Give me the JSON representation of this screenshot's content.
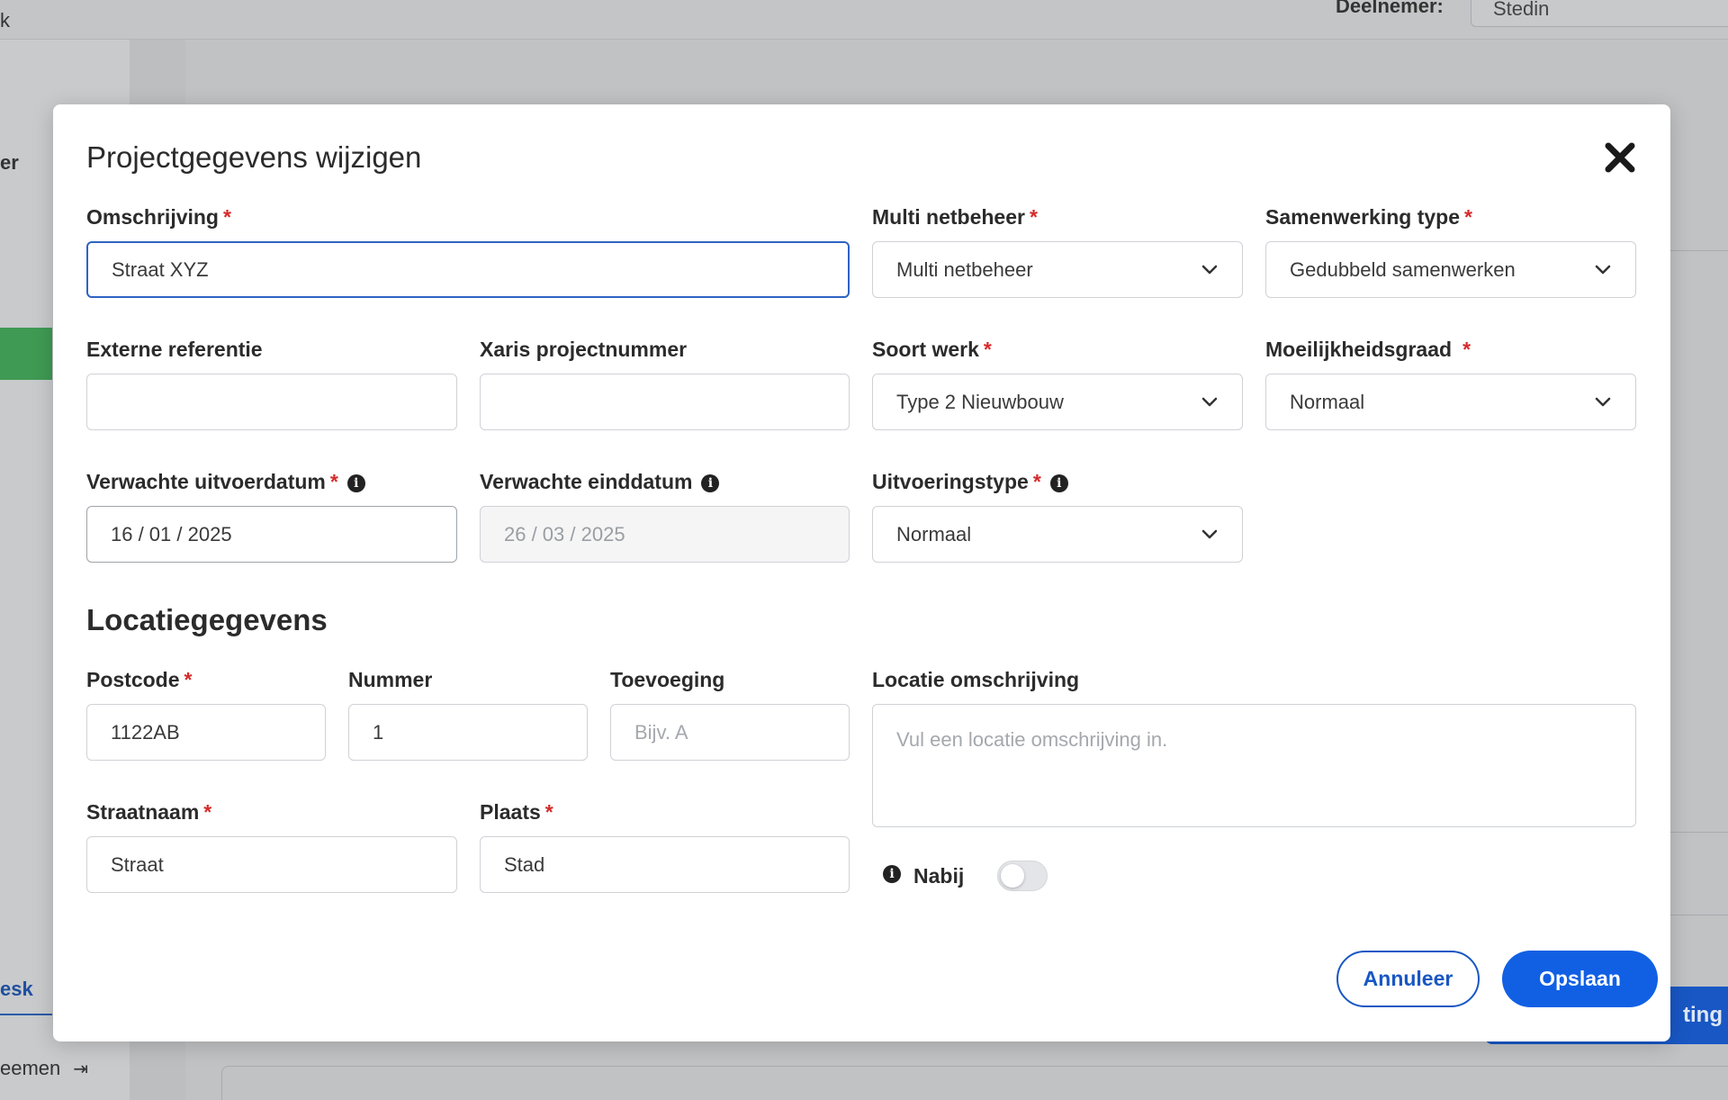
{
  "background": {
    "top_label": "Deelnemer:",
    "top_select_value": "Stedin",
    "sidebar_fragment_top": "k",
    "sidebar_fragment_mid": "er",
    "sidebar_fragment_link": "esk",
    "sidebar_fragment_bottom": "eemen",
    "bg_button_fragment": "ting o"
  },
  "modal": {
    "title": "Projectgegevens wijzigen",
    "close_icon": "close-x-icon",
    "required_mark": "*",
    "fields": {
      "omschrijving": {
        "label": "Omschrijving",
        "value": "Straat XYZ"
      },
      "multi_netbeheer": {
        "label": "Multi netbeheer",
        "value": "Multi netbeheer"
      },
      "samenwerking_type": {
        "label": "Samenwerking type",
        "value": "Gedubbeld samenwerken"
      },
      "externe_referentie": {
        "label": "Externe referentie",
        "value": ""
      },
      "xaris_projectnummer": {
        "label": "Xaris projectnummer",
        "value": ""
      },
      "soort_werk": {
        "label": "Soort werk",
        "value": "Type 2 Nieuwbouw"
      },
      "moeilijkheidsgraad": {
        "label": "Moeilijkheidsgraad",
        "value": "Normaal"
      },
      "verwachte_uitvoerdatum": {
        "label": "Verwachte uitvoerdatum",
        "value": "16 / 01 / 2025"
      },
      "verwachte_einddatum": {
        "label": "Verwachte einddatum",
        "value": "26 / 03 / 2025"
      },
      "uitvoeringstype": {
        "label": "Uitvoeringstype",
        "value": "Normaal"
      }
    },
    "location": {
      "section_title": "Locatiegegevens",
      "postcode": {
        "label": "Postcode",
        "value": "1122AB"
      },
      "nummer": {
        "label": "Nummer",
        "value": "1"
      },
      "toevoeging": {
        "label": "Toevoeging",
        "placeholder": "Bijv. A"
      },
      "locatie_omschrijving": {
        "label": "Locatie omschrijving",
        "placeholder": "Vul een locatie omschrijving in."
      },
      "straatnaam": {
        "label": "Straatnaam",
        "value": "Straat"
      },
      "plaats": {
        "label": "Plaats",
        "value": "Stad"
      },
      "nabij": {
        "label": "Nabij",
        "enabled": false
      }
    },
    "buttons": {
      "cancel": "Annuleer",
      "save": "Opslaan"
    },
    "colors": {
      "primary": "#1160e4",
      "required": "#d62b2b",
      "focus_border": "#2f63c4"
    }
  }
}
